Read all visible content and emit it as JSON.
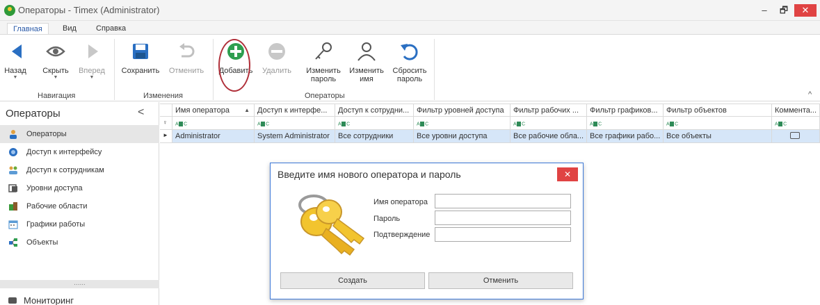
{
  "window": {
    "title": "Операторы - Timex (Administrator)",
    "minimize": "–",
    "maximize": "🗗",
    "close": "✕"
  },
  "menu": {
    "tabs": [
      {
        "label": "Главная",
        "active": true
      },
      {
        "label": "Вид",
        "active": false
      },
      {
        "label": "Справка",
        "active": false
      }
    ]
  },
  "ribbon": {
    "navigation": {
      "group_label": "Навигация",
      "back": "Назад",
      "hide": "Скрыть",
      "forward": "Вперед"
    },
    "changes": {
      "group_label": "Изменения",
      "save": "Сохранить",
      "undo": "Отменить"
    },
    "operators": {
      "group_label": "Операторы",
      "add": "Добавить",
      "delete": "Удалить",
      "change_password_1": "Изменить",
      "change_password_2": "пароль",
      "change_name_1": "Изменить",
      "change_name_2": "имя",
      "reset_password_1": "Сбросить",
      "reset_password_2": "пароль"
    },
    "collapse": "^"
  },
  "sidebar": {
    "title": "Операторы",
    "collapse": "<",
    "items": [
      {
        "label": "Операторы",
        "icon": "user-icon",
        "active": true
      },
      {
        "label": "Доступ к интерфейсу",
        "icon": "interface-access-icon",
        "active": false
      },
      {
        "label": "Доступ к сотрудникам",
        "icon": "employees-access-icon",
        "active": false
      },
      {
        "label": "Уровни доступа",
        "icon": "access-levels-icon",
        "active": false
      },
      {
        "label": "Рабочие области",
        "icon": "work-areas-icon",
        "active": false
      },
      {
        "label": "Графики работы",
        "icon": "calendar-icon",
        "active": false
      },
      {
        "label": "Объекты",
        "icon": "objects-icon",
        "active": false
      }
    ],
    "dots": "......",
    "bottom": "Мониторинг"
  },
  "grid": {
    "columns": [
      "Имя оператора",
      "Доступ к интерфе...",
      "Доступ к сотрудни...",
      "Фильтр уровней доступа",
      "Фильтр рабочих ...",
      "Фильтр графиков...",
      "Фильтр объектов",
      "Коммента..."
    ],
    "filter_row_icon": "ABC",
    "rows": [
      [
        "Administrator",
        "System Administrator",
        "Все сотрудники",
        "Все уровни доступа",
        "Все рабочие обла...",
        "Все графики рабо...",
        "Все объекты",
        ""
      ]
    ]
  },
  "dialog": {
    "title": "Введите имя нового оператора и пароль",
    "close": "✕",
    "username_label": "Имя оператора",
    "username_value": "",
    "password_label": "Пароль",
    "password_value": "",
    "confirm_label": "Подтверждение",
    "confirm_value": "",
    "create_button": "Создать",
    "cancel_button": "Отменить"
  },
  "colors": {
    "accent": "#2a5aa8",
    "selected_row": "#d6e6f8",
    "close_red": "#e04343",
    "add_green": "#2e9e4f",
    "highlight_ring": "#b0303a"
  }
}
